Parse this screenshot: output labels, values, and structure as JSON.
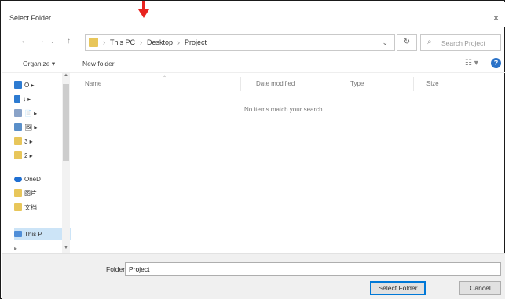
{
  "window": {
    "title": "Select Folder",
    "close_glyph": "×"
  },
  "annotation": {
    "arrow_color": "#e8231f"
  },
  "address": {
    "back_glyph": "←",
    "forward_glyph": "→",
    "up_glyph": "↑",
    "crumbs": [
      "This PC",
      "Desktop",
      "Project"
    ],
    "crumb_separator": "›",
    "dropdown_glyph": "⌄",
    "refresh_glyph": "↻"
  },
  "search": {
    "placeholder": "Search Project",
    "icon": "search-icon"
  },
  "toolbar": {
    "organize_label": "Organize ▾",
    "new_folder_label": "New folder",
    "view_glyph": "☷ ▾",
    "help_glyph": "?"
  },
  "nav": {
    "items": [
      {
        "label": "Ö ▸",
        "icon": "desktop-icon",
        "color": "#2d7bd1"
      },
      {
        "label": "↓ ▸",
        "icon": "downloads-icon",
        "color": "#2d7bd1"
      },
      {
        "label": "📄 ▸",
        "icon": "documents-icon",
        "color": "#6b89b6"
      },
      {
        "label": "🖼 ▸",
        "icon": "pictures-icon",
        "color": "#5a8fc9"
      },
      {
        "label": "3 ▸",
        "icon": "folder-icon",
        "color": "#e8c65a"
      },
      {
        "label": "2 ▸",
        "icon": "folder-icon",
        "color": "#e8c65a"
      },
      {
        "label": "OneD",
        "icon": "onedrive-icon",
        "color": "#1f6fd2"
      },
      {
        "label": "图片",
        "icon": "pictures-folder-icon",
        "color": "#e8c65a"
      },
      {
        "label": "文档",
        "icon": "documents-folder-icon",
        "color": "#e8c65a"
      },
      {
        "label": "This P",
        "icon": "this-pc-icon",
        "color": "#4f8ed8"
      }
    ]
  },
  "filelist": {
    "columns": [
      "Name",
      "Date modified",
      "Type",
      "Size"
    ],
    "empty_message": "No items match your search."
  },
  "bottom": {
    "folder_label": "Folder:",
    "folder_value": "Project",
    "select_button": "Select Folder",
    "cancel_button": "Cancel"
  }
}
